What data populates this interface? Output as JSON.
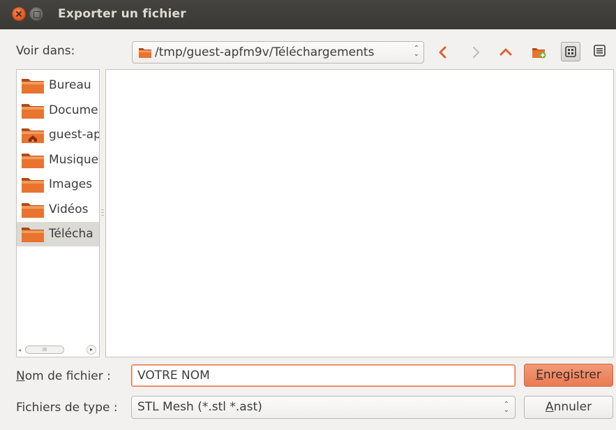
{
  "window": {
    "title": "Exporter un fichier"
  },
  "location": {
    "label": "Voir dans:",
    "path": "/tmp/guest-apfm9v/Téléchargements"
  },
  "toolbar": {
    "back_icon": "chevron-left-icon",
    "forward_icon": "chevron-right-icon",
    "up_icon": "chevron-up-icon",
    "new_folder_icon": "new-folder-icon",
    "icon_view_icon": "icon-view-icon",
    "detail_view_icon": "detail-view-icon"
  },
  "sidebar": {
    "items": [
      {
        "label": "Bureau",
        "icon": "folder-icon",
        "selected": false
      },
      {
        "label": "Docume",
        "icon": "folder-icon",
        "selected": false
      },
      {
        "label": "guest-ap",
        "icon": "home-folder-icon",
        "selected": false
      },
      {
        "label": "Musique",
        "icon": "folder-icon",
        "selected": false
      },
      {
        "label": "Images",
        "icon": "folder-icon",
        "selected": false
      },
      {
        "label": "Vidéos",
        "icon": "folder-icon",
        "selected": false
      },
      {
        "label": "Télécha",
        "icon": "folder-icon",
        "selected": true
      }
    ]
  },
  "filename": {
    "label_prefix": "N",
    "label_rest": "om de fichier :",
    "value": "VOTRE NOM"
  },
  "filetype": {
    "label": "Fichiers de type :",
    "selected": "STL Mesh (*.stl *.ast)"
  },
  "buttons": {
    "save_prefix": "E",
    "save_rest": "nregistrer",
    "cancel_prefix": "A",
    "cancel_rest": "nnuler"
  },
  "colors": {
    "accent": "#e9703f",
    "titlebar": "#3c3b37",
    "folder": "#e06a2c"
  }
}
